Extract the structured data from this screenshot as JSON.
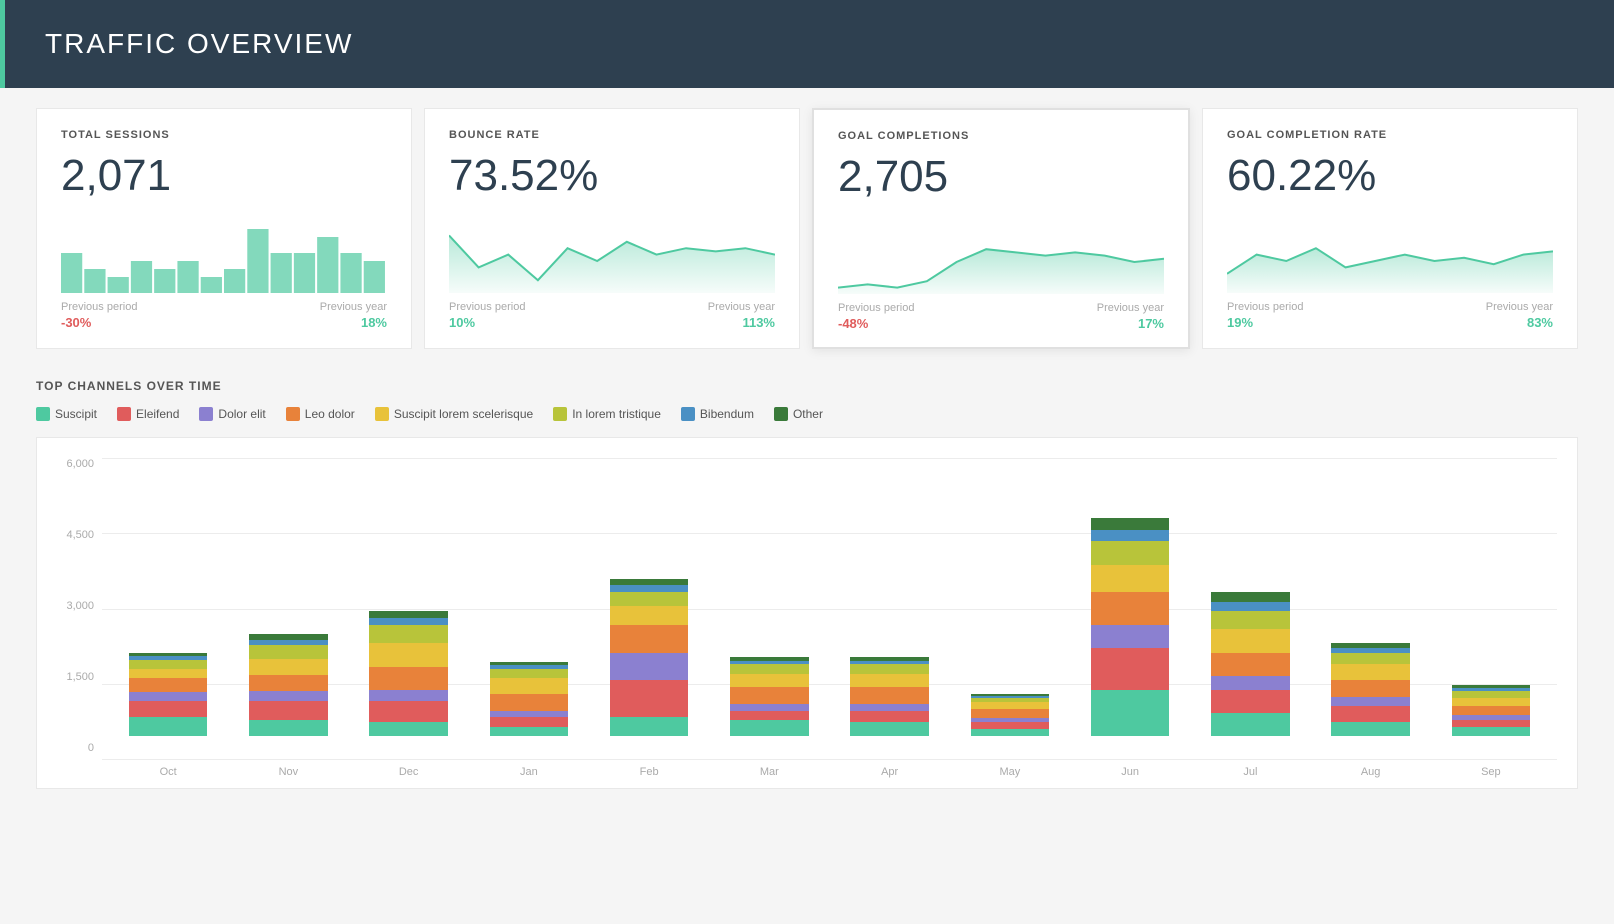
{
  "header": {
    "title": "TRAFFIC OVERVIEW",
    "accent_color": "#4ec9a0"
  },
  "metrics": [
    {
      "id": "total-sessions",
      "title": "TOTAL SESSIONS",
      "value": "2,071",
      "highlighted": false,
      "previous_period_label": "Previous period",
      "previous_year_label": "Previous year",
      "previous_period_change": "-30%",
      "previous_year_change": "18%",
      "period_negative": true,
      "year_negative": false
    },
    {
      "id": "bounce-rate",
      "title": "BOUNCE RATE",
      "value": "73.52%",
      "highlighted": false,
      "previous_period_label": "Previous period",
      "previous_year_label": "Previous year",
      "previous_period_change": "10%",
      "previous_year_change": "113%",
      "period_negative": false,
      "year_negative": false
    },
    {
      "id": "goal-completions",
      "title": "GOAL COMPLETIONS",
      "value": "2,705",
      "highlighted": true,
      "previous_period_label": "Previous period",
      "previous_year_label": "Previous year",
      "previous_period_change": "-48%",
      "previous_year_change": "17%",
      "period_negative": true,
      "year_negative": false
    },
    {
      "id": "goal-completion-rate",
      "title": "GOAL COMPLETION RATE",
      "value": "60.22%",
      "highlighted": false,
      "previous_period_label": "Previous period",
      "previous_year_label": "Previous year",
      "previous_period_change": "19%",
      "previous_year_change": "83%",
      "period_negative": false,
      "year_negative": false
    }
  ],
  "channels_section": {
    "title": "TOP CHANNELS OVER TIME",
    "legend": [
      {
        "label": "Suscipit",
        "color": "#4ec9a0"
      },
      {
        "label": "Eleifend",
        "color": "#e05c5c"
      },
      {
        "label": "Dolor elit",
        "color": "#8b80d0"
      },
      {
        "label": "Leo dolor",
        "color": "#e8823a"
      },
      {
        "label": "Suscipit lorem scelerisque",
        "color": "#e8c23a"
      },
      {
        "label": "In lorem tristique",
        "color": "#b8c43a"
      },
      {
        "label": "Bibendum",
        "color": "#4a90c4"
      },
      {
        "label": "Other",
        "color": "#3a7a3a"
      }
    ],
    "y_labels": [
      "6,000",
      "4,500",
      "3,000",
      "1,500",
      "0"
    ],
    "x_labels": [
      "Oct",
      "Nov",
      "Dec",
      "Jan",
      "Feb",
      "Mar",
      "Apr",
      "May",
      "Jun",
      "Jul",
      "Aug",
      "Sep"
    ],
    "bars": [
      {
        "month": "Oct",
        "total": 1800,
        "segments": [
          400,
          350,
          200,
          300,
          200,
          200,
          80,
          70
        ]
      },
      {
        "month": "Nov",
        "total": 2200,
        "segments": [
          350,
          400,
          220,
          350,
          350,
          300,
          100,
          130
        ]
      },
      {
        "month": "Dec",
        "total": 2700,
        "segments": [
          300,
          450,
          250,
          500,
          500,
          400,
          150,
          150
        ]
      },
      {
        "month": "Jan",
        "total": 1600,
        "segments": [
          200,
          200,
          150,
          350,
          350,
          200,
          80,
          70
        ]
      },
      {
        "month": "Feb",
        "total": 3400,
        "segments": [
          400,
          800,
          600,
          600,
          400,
          300,
          150,
          150
        ]
      },
      {
        "month": "Mar",
        "total": 1700,
        "segments": [
          350,
          200,
          150,
          350,
          300,
          200,
          80,
          70
        ]
      },
      {
        "month": "Apr",
        "total": 1700,
        "segments": [
          300,
          250,
          150,
          350,
          300,
          200,
          80,
          70
        ]
      },
      {
        "month": "May",
        "total": 900,
        "segments": [
          150,
          150,
          80,
          200,
          150,
          100,
          40,
          30
        ]
      },
      {
        "month": "Jun",
        "total": 4700,
        "segments": [
          1000,
          900,
          500,
          700,
          600,
          500,
          250,
          250
        ]
      },
      {
        "month": "Jul",
        "total": 3100,
        "segments": [
          500,
          500,
          300,
          500,
          500,
          400,
          200,
          200
        ]
      },
      {
        "month": "Aug",
        "total": 2000,
        "segments": [
          300,
          350,
          200,
          350,
          350,
          250,
          100,
          100
        ]
      },
      {
        "month": "Sep",
        "total": 1100,
        "segments": [
          200,
          150,
          100,
          200,
          180,
          150,
          60,
          60
        ]
      }
    ],
    "max_value": 6000
  }
}
